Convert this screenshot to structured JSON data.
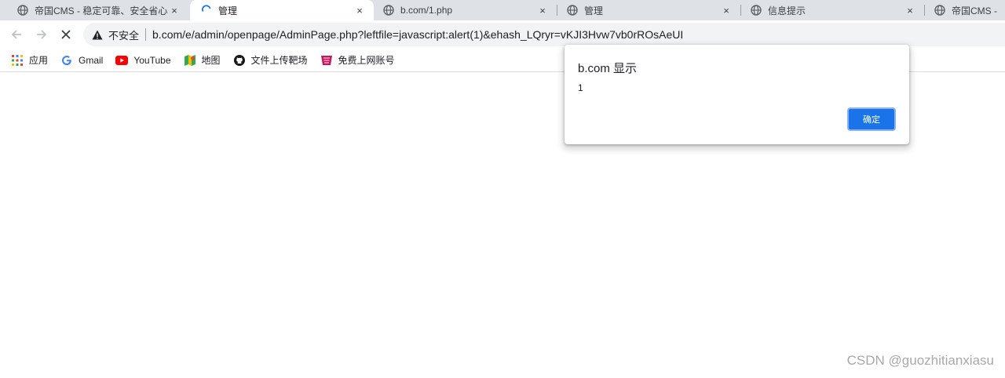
{
  "tabs": [
    {
      "title": "帝国CMS - 稳定可靠、安全省心",
      "icon": "globe-icon",
      "close": "×",
      "active": false
    },
    {
      "title": "管理",
      "icon": "loading-spinner-icon",
      "close": "×",
      "active": true
    },
    {
      "title": "b.com/1.php",
      "icon": "globe-icon",
      "close": "×",
      "active": false
    },
    {
      "title": "管理",
      "icon": "globe-icon",
      "close": "×",
      "active": false
    },
    {
      "title": "信息提示",
      "icon": "globe-icon",
      "close": "×",
      "active": false
    },
    {
      "title": "帝国CMS -",
      "icon": "globe-icon",
      "close": "",
      "active": false
    }
  ],
  "omnibox": {
    "security_label": "不安全",
    "url": "b.com/e/admin/openpage/AdminPage.php?leftfile=javascript:alert(1)&ehash_LQryr=vKJI3Hvw7vb0rROsAeUI"
  },
  "bookmarks": [
    {
      "label": "应用",
      "icon": "apps-grid-icon"
    },
    {
      "label": "Gmail",
      "icon": "google-icon"
    },
    {
      "label": "YouTube",
      "icon": "youtube-icon"
    },
    {
      "label": "地图",
      "icon": "maps-icon"
    },
    {
      "label": "文件上传靶场",
      "icon": "github-icon"
    },
    {
      "label": "免费上网账号",
      "icon": "bookmark-logo-icon"
    }
  ],
  "dialog": {
    "title": "b.com 显示",
    "message": "1",
    "ok_label": "确定"
  },
  "watermark": "CSDN @guozhitianxiasu",
  "colors": {
    "tabstrip": "#dee1e6",
    "accent": "#1a73e8",
    "omnibox": "#f1f3f4"
  }
}
